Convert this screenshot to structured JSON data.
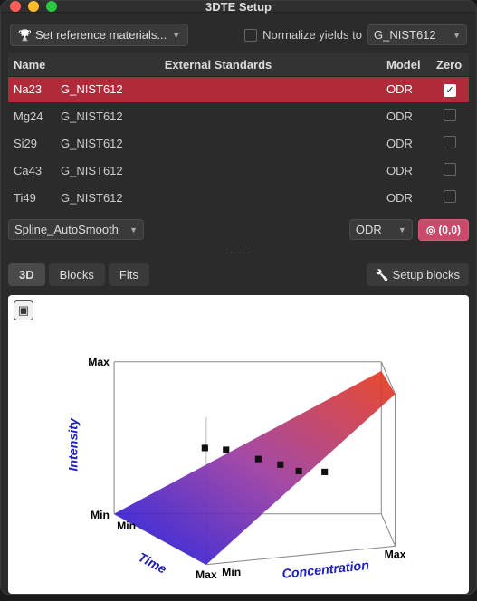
{
  "window": {
    "title": "3DTE Setup"
  },
  "toolbar": {
    "set_ref_label": "Set reference materials...",
    "normalize_label": "Normalize yields to",
    "normalize_checked": false,
    "normalize_select": "G_NIST612"
  },
  "table": {
    "headers": {
      "name": "Name",
      "ext_std": "External Standards",
      "model": "Model",
      "zero": "Zero"
    },
    "rows": [
      {
        "name": "Na23",
        "std": "G_NIST612",
        "model": "ODR",
        "zero": true,
        "selected": true
      },
      {
        "name": "Mg24",
        "std": "G_NIST612",
        "model": "ODR",
        "zero": false,
        "selected": false
      },
      {
        "name": "Si29",
        "std": "G_NIST612",
        "model": "ODR",
        "zero": false,
        "selected": false
      },
      {
        "name": "Ca43",
        "std": "G_NIST612",
        "model": "ODR",
        "zero": false,
        "selected": false
      },
      {
        "name": "Ti49",
        "std": "G_NIST612",
        "model": "ODR",
        "zero": false,
        "selected": false
      }
    ]
  },
  "second_toolbar": {
    "spline_select": "Spline_AutoSmooth",
    "model_select": "ODR",
    "zero_btn": "(0,0)"
  },
  "tabs": {
    "items": [
      {
        "id": "3d",
        "label": "3D",
        "active": true
      },
      {
        "id": "blocks",
        "label": "Blocks",
        "active": false
      },
      {
        "id": "fits",
        "label": "Fits",
        "active": false
      }
    ],
    "setup_blocks": "Setup blocks"
  },
  "plot": {
    "axes": {
      "z": {
        "label": "Intensity",
        "min": "Min",
        "max": "Max"
      },
      "x": {
        "label": "Time",
        "min": "Min",
        "max": "Max"
      },
      "y": {
        "label": "Concentration",
        "min": "Min",
        "max": "Max"
      }
    }
  },
  "chart_data": {
    "type": "3d-surface",
    "title": "",
    "axes": {
      "x": {
        "label": "Time",
        "range": [
          "Min",
          "Max"
        ]
      },
      "y": {
        "label": "Concentration",
        "range": [
          "Min",
          "Max"
        ]
      },
      "z": {
        "label": "Intensity",
        "range": [
          "Min",
          "Max"
        ]
      }
    },
    "surface": {
      "description": "Planar gradient surface where Intensity increases roughly linearly with Concentration (low=blue to high=red), approximately constant over Time",
      "color_low": "#1616e0",
      "color_high": "#e83a1a"
    },
    "scatter_points": [
      {
        "time": 0.35,
        "concentration": 0.4,
        "intensity": 0.4
      },
      {
        "time": 0.45,
        "concentration": 0.42,
        "intensity": 0.42
      },
      {
        "time": 0.55,
        "concentration": 0.46,
        "intensity": 0.46
      },
      {
        "time": 0.62,
        "concentration": 0.48,
        "intensity": 0.48
      },
      {
        "time": 0.7,
        "concentration": 0.5,
        "intensity": 0.5
      },
      {
        "time": 0.8,
        "concentration": 0.5,
        "intensity": 0.5
      }
    ],
    "note": "Point coordinates are estimated normalized positions (0=Min, 1=Max) read from the projected 3D view."
  }
}
